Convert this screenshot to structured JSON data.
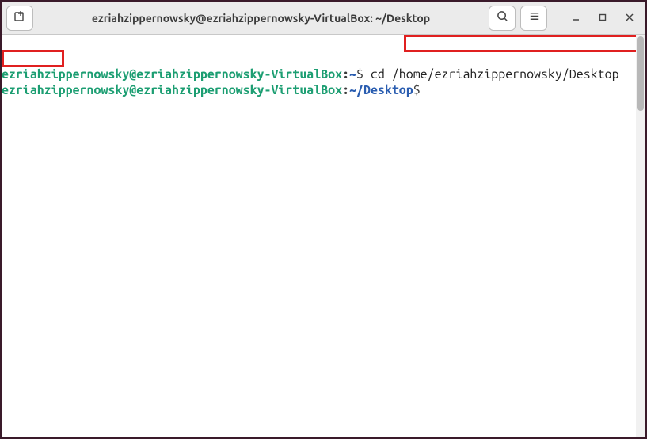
{
  "titlebar": {
    "title": "ezriahzippernowsky@ezriahzippernowsky-VirtualBox: ~/Desktop",
    "icons": {
      "new_tab": "new-tab-icon",
      "search": "search-icon",
      "menu": "menu-icon",
      "minimize": "minimize-icon",
      "maximize": "maximize-icon",
      "close": "close-icon"
    }
  },
  "terminal": {
    "lines": [
      {
        "user_host": "ezriahzippernowsky@ezriahzippernowsky-VirtualBox",
        "colon": ":",
        "path": "~",
        "dollar": "$",
        "command": " cd /home/ezriahzippernowsky/Desktop"
      },
      {
        "user_host": "ezriahzippernowsky@ezriahzippernowsky-VirtualBox",
        "colon": ":",
        "path": "~/Desktop",
        "dollar": "$",
        "command": ""
      }
    ]
  }
}
